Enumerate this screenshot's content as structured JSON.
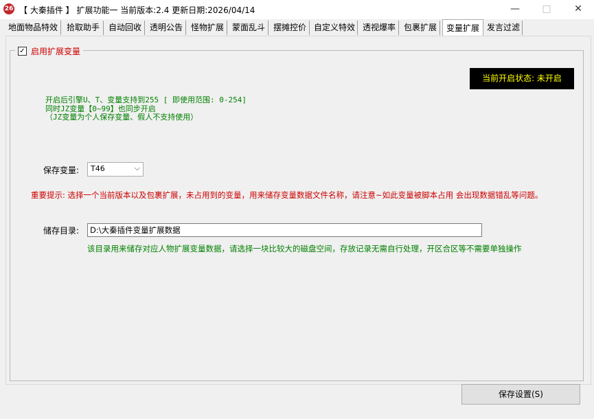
{
  "window": {
    "title": "【 大秦插件 】 扩展功能一 当前版本:2.4 更新日期:2026/04/14",
    "icon_text": "26",
    "minimize": "—",
    "maximize": "□",
    "close": "✕"
  },
  "tabs": [
    {
      "label": "地面物品特效"
    },
    {
      "label": "拾取助手"
    },
    {
      "label": "自动回收"
    },
    {
      "label": "透明公告"
    },
    {
      "label": "怪物扩展"
    },
    {
      "label": "蒙面乱斗"
    },
    {
      "label": "摆摊控价"
    },
    {
      "label": "自定义特效"
    },
    {
      "label": "透视爆率"
    },
    {
      "label": "包裹扩展"
    },
    {
      "label": "变量扩展",
      "active": true
    },
    {
      "label": "发言过滤"
    }
  ],
  "group": {
    "checkbox_checked": true,
    "label": "启用扩展变量"
  },
  "status": {
    "text": "当前开启状态: 未开启"
  },
  "info_lines": [
    "开启后引擎U、T、变量支持到255 [ 即使用范围: 0-254]",
    "同时JZ变量【0~99】也同步开启",
    "（JZ变量为个人保存变量、假人不支持使用）"
  ],
  "save_var": {
    "label": "保存变量:",
    "value": "T46"
  },
  "warning": "重要提示: 选择一个当前版本以及包裹扩展，未占用到的变量，用来储存变量数据文件名称，请注意~如此变量被脚本占用 会出现数据错乱等问题。",
  "storage": {
    "label": "储存目录:",
    "value": "D:\\大秦插件变量扩展数据",
    "hint": "该目录用来储存对应人物扩展变量数据，请选择一块比较大的磁盘空间，存放记录无需自行处理，开区合区等不需要单独操作"
  },
  "save_button": "保存设置(S)",
  "colors": {
    "accent_red": "#cc0000",
    "info_green": "#008000",
    "status_bg": "#000000",
    "status_fg": "#ffff00"
  }
}
